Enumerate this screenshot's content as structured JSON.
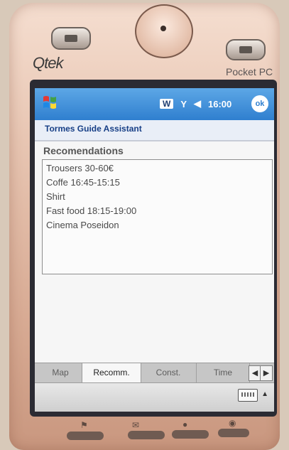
{
  "device": {
    "brand": "Qtek",
    "model": "Pocket PC"
  },
  "status_bar": {
    "w_label": "W",
    "signal_label": "Y",
    "volume_label": "◀",
    "time": "16:00",
    "ok_label": "ok"
  },
  "app": {
    "title": "Tormes Guide Assistant"
  },
  "section": {
    "title": "Recomendations"
  },
  "recommendations": [
    "Trousers 30-60€",
    "Coffe 16:45-15:15",
    "Shirt",
    "Fast food 18:15-19:00",
    "Cinema Poseidon"
  ],
  "tabs": [
    {
      "label": "Map"
    },
    {
      "label": "Recomm."
    },
    {
      "label": "Const."
    },
    {
      "label": "Time"
    }
  ],
  "tab_scroll": {
    "left": "◀",
    "right": "▶"
  },
  "menu": {
    "up_arrow": "▲"
  },
  "icons": {
    "start": "windows-flag-icon",
    "keyboard": "keyboard-icon",
    "signal": "signal-icon",
    "volume": "volume-icon"
  },
  "colors": {
    "taskbar": "#2f7fcf",
    "title_text": "#173f86",
    "device_body": "#e8c6b3"
  }
}
